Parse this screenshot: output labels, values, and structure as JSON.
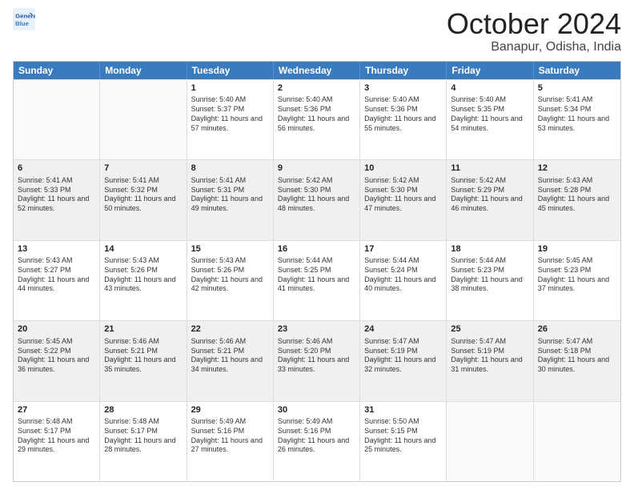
{
  "header": {
    "logo_line1": "General",
    "logo_line2": "Blue",
    "month": "October 2024",
    "location": "Banapur, Odisha, India"
  },
  "weekdays": [
    "Sunday",
    "Monday",
    "Tuesday",
    "Wednesday",
    "Thursday",
    "Friday",
    "Saturday"
  ],
  "rows": [
    [
      {
        "day": "",
        "sunrise": "",
        "sunset": "",
        "daylight": "",
        "empty": true
      },
      {
        "day": "",
        "sunrise": "",
        "sunset": "",
        "daylight": "",
        "empty": true
      },
      {
        "day": "1",
        "sunrise": "Sunrise: 5:40 AM",
        "sunset": "Sunset: 5:37 PM",
        "daylight": "Daylight: 11 hours and 57 minutes.",
        "empty": false
      },
      {
        "day": "2",
        "sunrise": "Sunrise: 5:40 AM",
        "sunset": "Sunset: 5:36 PM",
        "daylight": "Daylight: 11 hours and 56 minutes.",
        "empty": false
      },
      {
        "day": "3",
        "sunrise": "Sunrise: 5:40 AM",
        "sunset": "Sunset: 5:36 PM",
        "daylight": "Daylight: 11 hours and 55 minutes.",
        "empty": false
      },
      {
        "day": "4",
        "sunrise": "Sunrise: 5:40 AM",
        "sunset": "Sunset: 5:35 PM",
        "daylight": "Daylight: 11 hours and 54 minutes.",
        "empty": false
      },
      {
        "day": "5",
        "sunrise": "Sunrise: 5:41 AM",
        "sunset": "Sunset: 5:34 PM",
        "daylight": "Daylight: 11 hours and 53 minutes.",
        "empty": false
      }
    ],
    [
      {
        "day": "6",
        "sunrise": "Sunrise: 5:41 AM",
        "sunset": "Sunset: 5:33 PM",
        "daylight": "Daylight: 11 hours and 52 minutes.",
        "empty": false
      },
      {
        "day": "7",
        "sunrise": "Sunrise: 5:41 AM",
        "sunset": "Sunset: 5:32 PM",
        "daylight": "Daylight: 11 hours and 50 minutes.",
        "empty": false
      },
      {
        "day": "8",
        "sunrise": "Sunrise: 5:41 AM",
        "sunset": "Sunset: 5:31 PM",
        "daylight": "Daylight: 11 hours and 49 minutes.",
        "empty": false
      },
      {
        "day": "9",
        "sunrise": "Sunrise: 5:42 AM",
        "sunset": "Sunset: 5:30 PM",
        "daylight": "Daylight: 11 hours and 48 minutes.",
        "empty": false
      },
      {
        "day": "10",
        "sunrise": "Sunrise: 5:42 AM",
        "sunset": "Sunset: 5:30 PM",
        "daylight": "Daylight: 11 hours and 47 minutes.",
        "empty": false
      },
      {
        "day": "11",
        "sunrise": "Sunrise: 5:42 AM",
        "sunset": "Sunset: 5:29 PM",
        "daylight": "Daylight: 11 hours and 46 minutes.",
        "empty": false
      },
      {
        "day": "12",
        "sunrise": "Sunrise: 5:43 AM",
        "sunset": "Sunset: 5:28 PM",
        "daylight": "Daylight: 11 hours and 45 minutes.",
        "empty": false
      }
    ],
    [
      {
        "day": "13",
        "sunrise": "Sunrise: 5:43 AM",
        "sunset": "Sunset: 5:27 PM",
        "daylight": "Daylight: 11 hours and 44 minutes.",
        "empty": false
      },
      {
        "day": "14",
        "sunrise": "Sunrise: 5:43 AM",
        "sunset": "Sunset: 5:26 PM",
        "daylight": "Daylight: 11 hours and 43 minutes.",
        "empty": false
      },
      {
        "day": "15",
        "sunrise": "Sunrise: 5:43 AM",
        "sunset": "Sunset: 5:26 PM",
        "daylight": "Daylight: 11 hours and 42 minutes.",
        "empty": false
      },
      {
        "day": "16",
        "sunrise": "Sunrise: 5:44 AM",
        "sunset": "Sunset: 5:25 PM",
        "daylight": "Daylight: 11 hours and 41 minutes.",
        "empty": false
      },
      {
        "day": "17",
        "sunrise": "Sunrise: 5:44 AM",
        "sunset": "Sunset: 5:24 PM",
        "daylight": "Daylight: 11 hours and 40 minutes.",
        "empty": false
      },
      {
        "day": "18",
        "sunrise": "Sunrise: 5:44 AM",
        "sunset": "Sunset: 5:23 PM",
        "daylight": "Daylight: 11 hours and 38 minutes.",
        "empty": false
      },
      {
        "day": "19",
        "sunrise": "Sunrise: 5:45 AM",
        "sunset": "Sunset: 5:23 PM",
        "daylight": "Daylight: 11 hours and 37 minutes.",
        "empty": false
      }
    ],
    [
      {
        "day": "20",
        "sunrise": "Sunrise: 5:45 AM",
        "sunset": "Sunset: 5:22 PM",
        "daylight": "Daylight: 11 hours and 36 minutes.",
        "empty": false
      },
      {
        "day": "21",
        "sunrise": "Sunrise: 5:46 AM",
        "sunset": "Sunset: 5:21 PM",
        "daylight": "Daylight: 11 hours and 35 minutes.",
        "empty": false
      },
      {
        "day": "22",
        "sunrise": "Sunrise: 5:46 AM",
        "sunset": "Sunset: 5:21 PM",
        "daylight": "Daylight: 11 hours and 34 minutes.",
        "empty": false
      },
      {
        "day": "23",
        "sunrise": "Sunrise: 5:46 AM",
        "sunset": "Sunset: 5:20 PM",
        "daylight": "Daylight: 11 hours and 33 minutes.",
        "empty": false
      },
      {
        "day": "24",
        "sunrise": "Sunrise: 5:47 AM",
        "sunset": "Sunset: 5:19 PM",
        "daylight": "Daylight: 11 hours and 32 minutes.",
        "empty": false
      },
      {
        "day": "25",
        "sunrise": "Sunrise: 5:47 AM",
        "sunset": "Sunset: 5:19 PM",
        "daylight": "Daylight: 11 hours and 31 minutes.",
        "empty": false
      },
      {
        "day": "26",
        "sunrise": "Sunrise: 5:47 AM",
        "sunset": "Sunset: 5:18 PM",
        "daylight": "Daylight: 11 hours and 30 minutes.",
        "empty": false
      }
    ],
    [
      {
        "day": "27",
        "sunrise": "Sunrise: 5:48 AM",
        "sunset": "Sunset: 5:17 PM",
        "daylight": "Daylight: 11 hours and 29 minutes.",
        "empty": false
      },
      {
        "day": "28",
        "sunrise": "Sunrise: 5:48 AM",
        "sunset": "Sunset: 5:17 PM",
        "daylight": "Daylight: 11 hours and 28 minutes.",
        "empty": false
      },
      {
        "day": "29",
        "sunrise": "Sunrise: 5:49 AM",
        "sunset": "Sunset: 5:16 PM",
        "daylight": "Daylight: 11 hours and 27 minutes.",
        "empty": false
      },
      {
        "day": "30",
        "sunrise": "Sunrise: 5:49 AM",
        "sunset": "Sunset: 5:16 PM",
        "daylight": "Daylight: 11 hours and 26 minutes.",
        "empty": false
      },
      {
        "day": "31",
        "sunrise": "Sunrise: 5:50 AM",
        "sunset": "Sunset: 5:15 PM",
        "daylight": "Daylight: 11 hours and 25 minutes.",
        "empty": false
      },
      {
        "day": "",
        "sunrise": "",
        "sunset": "",
        "daylight": "",
        "empty": true
      },
      {
        "day": "",
        "sunrise": "",
        "sunset": "",
        "daylight": "",
        "empty": true
      }
    ]
  ]
}
